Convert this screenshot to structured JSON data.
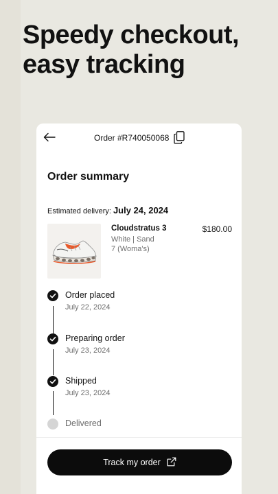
{
  "headline": {
    "line1": "Speedy checkout,",
    "line2": "easy tracking"
  },
  "colors": {
    "background": "#e4e2d9",
    "card": "#ffffff",
    "accent": "#0c0c0c",
    "pending": "#d5d5d5"
  },
  "order": {
    "id_label": "Order #R740050068",
    "title": "Order summary",
    "delivery_label": "Estimated delivery:",
    "delivery_date": "July 24, 2024"
  },
  "product": {
    "name": "Cloudstratus 3",
    "price": "$180.00",
    "variant": "White | Sand",
    "size": "7  (Woma's)",
    "image_icon": "running-shoe-image"
  },
  "steps": [
    {
      "label": "Order placed",
      "date": "July 22, 2024",
      "status": "done"
    },
    {
      "label": "Preparing order",
      "date": "July 23, 2024",
      "status": "done"
    },
    {
      "label": "Shipped",
      "date": "July 23, 2024",
      "status": "done"
    },
    {
      "label": "Delivered",
      "date": "",
      "status": "pending"
    }
  ],
  "actions": {
    "track_label": "Track my order"
  },
  "icons": {
    "back": "arrow-left-icon",
    "copy": "copy-icon",
    "check": "check-icon",
    "external": "external-link-icon"
  }
}
